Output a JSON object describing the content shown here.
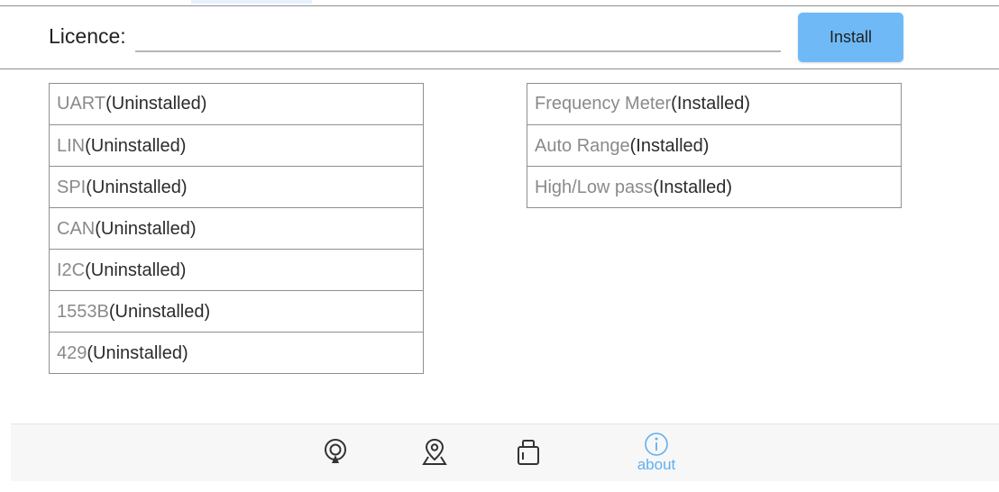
{
  "licence": {
    "label": "Licence:",
    "value": "",
    "placeholder": ""
  },
  "install_button": {
    "label": "Install"
  },
  "modules_left": [
    {
      "name": "UART",
      "status": "(Uninstalled)"
    },
    {
      "name": "LIN",
      "status": "(Uninstalled)"
    },
    {
      "name": "SPI",
      "status": "(Uninstalled)"
    },
    {
      "name": "CAN",
      "status": "(Uninstalled)"
    },
    {
      "name": "I2C",
      "status": "(Uninstalled)"
    },
    {
      "name": "1553B",
      "status": "(Uninstalled)"
    },
    {
      "name": "429",
      "status": "(Uninstalled)"
    }
  ],
  "modules_right": [
    {
      "name": "Frequency Meter",
      "status": "(Installed)"
    },
    {
      "name": "Auto Range",
      "status": "(Installed)"
    },
    {
      "name": "High/Low pass",
      "status": "(Installed)"
    }
  ],
  "bottom_nav": [
    {
      "icon": "radar-pin-icon"
    },
    {
      "icon": "location-pin-icon"
    },
    {
      "icon": "chip-icon"
    },
    {
      "icon": "info-icon",
      "label": "about",
      "active": true
    }
  ],
  "colors": {
    "accent": "#6fbaf6",
    "active_nav": "#5fb0f2",
    "rule": "#8f8f8f"
  }
}
